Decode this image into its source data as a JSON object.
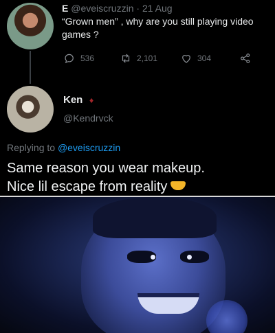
{
  "tweet": {
    "name": "E",
    "handle": "@eveiscruzzin",
    "separator": "·",
    "date": "21 Aug",
    "text": "“Grown men” , why are you still playing video games ?",
    "actions": {
      "replies": "536",
      "retweets": "2,101",
      "likes": "304"
    }
  },
  "reply": {
    "name": "Ken",
    "handle": "@Kendrvck",
    "replying_prefix": "Replying to",
    "replying_to": "@eveiscruzzin",
    "line1": "Same reason you wear makeup.",
    "line2": "Nice lil escape from reality"
  },
  "icons": {
    "reply": "speech-bubble-icon",
    "retweet": "retweet-icon",
    "like": "heart-icon",
    "share": "share-icon"
  },
  "colors": {
    "background": "#000000",
    "link": "#1d9bf0",
    "muted": "#71767b",
    "meme_tint": "#2e3f7a"
  }
}
